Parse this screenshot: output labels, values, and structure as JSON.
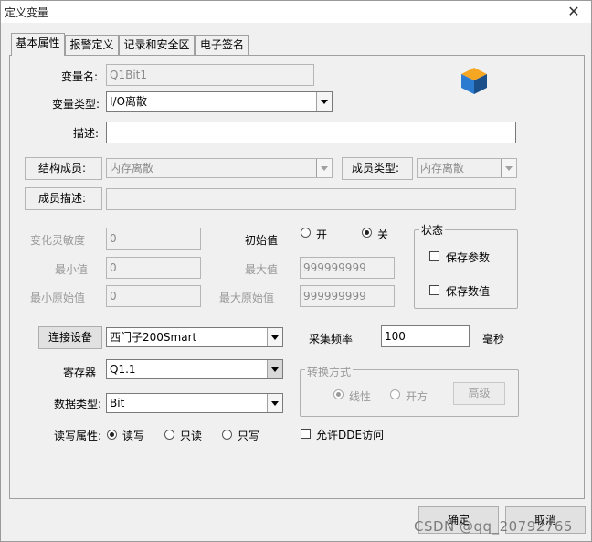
{
  "window": {
    "title": "定义变量",
    "close_glyph": "✕"
  },
  "tabs": [
    {
      "label": "基本属性"
    },
    {
      "label": "报警定义"
    },
    {
      "label": "记录和安全区"
    },
    {
      "label": "电子签名"
    }
  ],
  "form": {
    "var_name_label": "变量名:",
    "var_name_value": "Q1Bit1",
    "var_type_label": "变量类型:",
    "var_type_value": "I/O离散",
    "desc_label": "描述:",
    "desc_value": "",
    "struct_member_label": "结构成员:",
    "struct_member_value": "内存离散",
    "member_type_label": "成员类型:",
    "member_type_value": "内存离散",
    "member_desc_label": "成员描述:",
    "member_desc_value": "",
    "sensitivity_label": "变化灵敏度",
    "sensitivity_value": "0",
    "min_label": "最小值",
    "min_value": "0",
    "min_raw_label": "最小原始值",
    "min_raw_value": "0",
    "initial_label": "初始值",
    "initial_on_label": "开",
    "initial_off_label": "关",
    "max_label": "最大值",
    "max_value": "999999999",
    "max_raw_label": "最大原始值",
    "max_raw_value": "999999999",
    "state_group_label": "状态",
    "save_params_label": "保存参数",
    "save_value_label": "保存数值",
    "connect_button": "连接设备",
    "device_value": "西门子200Smart",
    "freq_label": "采集频率",
    "freq_value": "100",
    "freq_unit": "毫秒",
    "register_label": "寄存器",
    "register_value": "Q1.1",
    "convert_group_label": "转换方式",
    "linear_label": "线性",
    "sqrt_label": "开方",
    "advanced_button": "高级",
    "data_type_label": "数据类型:",
    "data_type_value": "Bit",
    "rw_label": "读写属性:",
    "rw_readwrite": "读写",
    "rw_readonly": "只读",
    "rw_writeonly": "只写",
    "dde_label": "允许DDE访问"
  },
  "footer": {
    "ok_button": "确定",
    "cancel_button": "取消"
  },
  "watermark": "CSDN @qq_20792765",
  "icon": {
    "name": "cube-icon",
    "colors": [
      "#f5a623",
      "#2b7bd0",
      "#1a4f8a"
    ]
  }
}
